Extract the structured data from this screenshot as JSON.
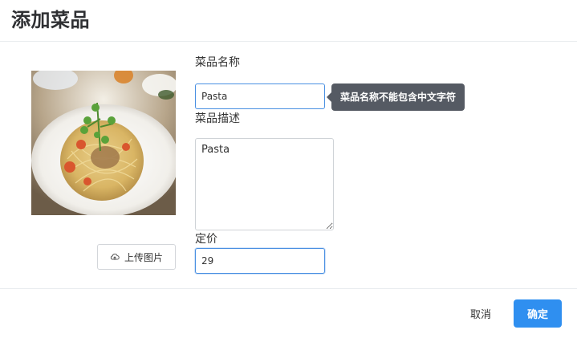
{
  "dialog": {
    "title": "添加菜品"
  },
  "image": {
    "alt": "Pasta",
    "upload_label": "上传图片",
    "upload_icon": "cloud-upload-icon"
  },
  "form": {
    "name_label": "菜品名称",
    "name_value": "Pasta",
    "name_tooltip": "菜品名称不能包含中文字符",
    "description_label": "菜品描述",
    "description_value": "Pasta",
    "price_label": "定价",
    "price_value": "29"
  },
  "footer": {
    "cancel_label": "取消",
    "confirm_label": "确定"
  },
  "colors": {
    "primary": "#2f8ff0",
    "tooltip_bg": "#555a63",
    "focus_border": "#4a90e2"
  }
}
